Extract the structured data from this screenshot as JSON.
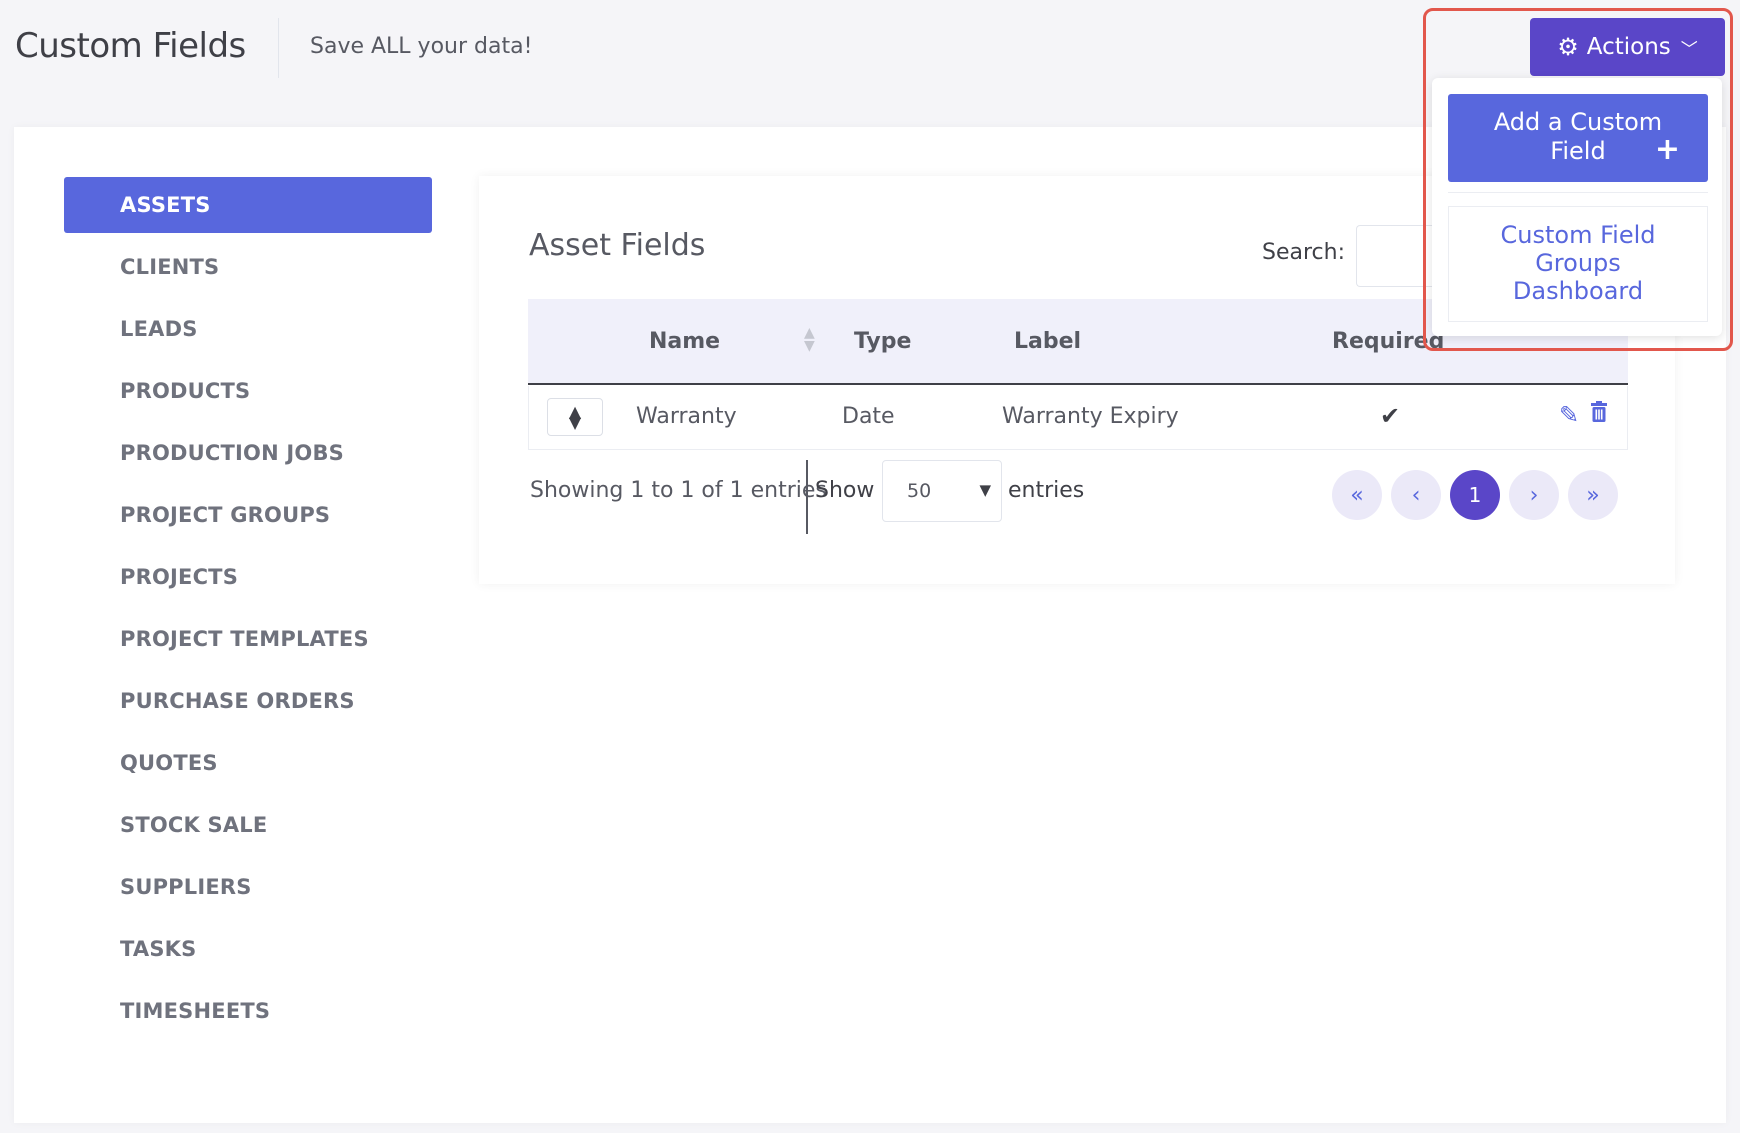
{
  "header": {
    "title": "Custom Fields",
    "subtitle": "Save ALL your data!",
    "actions_label": "Actions"
  },
  "dropdown": {
    "add_label": "Add a Custom Field",
    "groups_label": "Custom Field Groups Dashboard"
  },
  "sidebar": {
    "items": [
      {
        "label": "ASSETS",
        "active": true
      },
      {
        "label": "CLIENTS"
      },
      {
        "label": "LEADS"
      },
      {
        "label": "PRODUCTS"
      },
      {
        "label": "PRODUCTION JOBS"
      },
      {
        "label": "PROJECT GROUPS"
      },
      {
        "label": "PROJECTS"
      },
      {
        "label": "PROJECT TEMPLATES"
      },
      {
        "label": "PURCHASE ORDERS"
      },
      {
        "label": "QUOTES"
      },
      {
        "label": "STOCK SALE"
      },
      {
        "label": "SUPPLIERS"
      },
      {
        "label": "TASKS"
      },
      {
        "label": "TIMESHEETS"
      }
    ]
  },
  "section": {
    "title": "Asset Fields",
    "search_label": "Search:",
    "search_value": ""
  },
  "table": {
    "columns": [
      "Name",
      "Type",
      "Label",
      "Required"
    ],
    "rows": [
      {
        "name": "Warranty",
        "type": "Date",
        "label": "Warranty Expiry",
        "required": true
      }
    ]
  },
  "footer": {
    "info": "Showing 1 to 1 of 1 entries",
    "show_label": "Show",
    "page_size": "50",
    "entries_label": "entries",
    "current_page": "1"
  },
  "colors": {
    "accent": "#5867dd",
    "actions_bg": "#5a46c8",
    "highlight": "#e2574c"
  }
}
